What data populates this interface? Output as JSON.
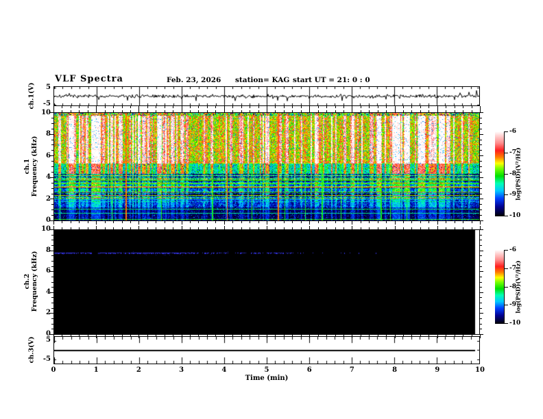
{
  "header": {
    "title": "VLF Spectra",
    "date": "Feb. 23, 2026",
    "station": "station= KAG",
    "start_ut": "start UT =  21: 0 : 0"
  },
  "chart_data": {
    "type": "heatmap",
    "title": "VLF Spectra",
    "xaxis": {
      "label": "Time (min)",
      "min": 0,
      "max": 10,
      "tick_labels": [
        "0",
        "1",
        "2",
        "3",
        "4",
        "5",
        "6",
        "7",
        "8",
        "9",
        "10"
      ],
      "minor_ticks_per_major": 5
    },
    "colorbar": {
      "label": "log(PSD)(V²/Hz)",
      "tick_labels": [
        "-6",
        "-7",
        "-8",
        "-9",
        "-10"
      ],
      "value_range": [
        -10,
        -6
      ],
      "colormap_stops": [
        [
          -10.0,
          "#000000"
        ],
        [
          -9.55,
          "#000090"
        ],
        [
          -9.15,
          "#0040ff"
        ],
        [
          -8.8,
          "#00c8ff"
        ],
        [
          -8.45,
          "#00ffb4"
        ],
        [
          -8.1,
          "#00e000"
        ],
        [
          -7.75,
          "#78ff00"
        ],
        [
          -7.5,
          "#ffff00"
        ],
        [
          -7.2,
          "#ff7800"
        ],
        [
          -6.9,
          "#ff1e1e"
        ],
        [
          -6.55,
          "#ff8c8c"
        ],
        [
          -6.2,
          "#ffd2d2"
        ],
        [
          -6.0,
          "#ffffff"
        ]
      ]
    },
    "panels": {
      "ch1_wave": {
        "ylabel": "ch.1(V)",
        "ytick_labels": [
          "5",
          "-5"
        ],
        "ylim_v": [
          -5,
          5
        ],
        "line_color": "#000000",
        "noise_amp_v": 0.45,
        "seed": 7,
        "notable_spikes": [
          {
            "t_min": 0.35,
            "amp_v": 1.6
          },
          {
            "t_min": 1.05,
            "amp_v": -1.9
          },
          {
            "t_min": 3.0,
            "amp_v": -1.5
          },
          {
            "t_min": 4.25,
            "amp_v": -2.6
          },
          {
            "t_min": 5.15,
            "amp_v": -1.4
          },
          {
            "t_min": 6.0,
            "amp_v": -1.3
          },
          {
            "t_min": 7.5,
            "amp_v": -1.2
          },
          {
            "t_min": 9.55,
            "amp_v": 1.9
          },
          {
            "t_min": 9.75,
            "amp_v": 2.3
          },
          {
            "t_min": 9.93,
            "amp_v": 3.2
          }
        ]
      },
      "ch1_spec": {
        "ylabel_line1": "ch.1",
        "ylabel_line2": "Frequency (kHz)",
        "ytick_labels": [
          "10",
          "8",
          "6",
          "4",
          "2",
          "0"
        ],
        "ylim_khz": [
          0,
          10
        ],
        "seed": 42,
        "description": "Dense broadband sferic activity: vertical red/white/green streaks above ~5 kHz, blue striped band 2-4 kHz, dark background below 2 kHz with narrowband lines",
        "bands": [
          {
            "f_min": 9.75,
            "f_max": 10.01,
            "base_psd": -8.0,
            "noise": 1.8,
            "streak_gain": 1.0,
            "speck_prob": 0.15,
            "speck_psd": -9.6
          },
          {
            "f_min": 5.3,
            "f_max": 9.75,
            "base_psd": -7.6,
            "noise": 1.3,
            "streak_gain": 1.9,
            "speck_prob": 0.05,
            "speck_psd": -8.9
          },
          {
            "f_min": 4.3,
            "f_max": 5.3,
            "base_psd": -8.55,
            "noise": 1.1,
            "streak_gain": 1.8,
            "speck_prob": 0.05,
            "speck_psd": -9.5
          },
          {
            "f_min": 2.0,
            "f_max": 4.3,
            "base_psd": -9.2,
            "noise": 0.9,
            "streak_gain": 1.25,
            "speck_prob": 0.04,
            "speck_psd": -8.4
          },
          {
            "f_min": 1.2,
            "f_max": 2.0,
            "base_psd": -9.4,
            "noise": 0.7,
            "streak_gain": 0.7,
            "speck_prob": 0.08,
            "speck_psd": -8.6
          },
          {
            "f_min": 0.0,
            "f_max": 1.2,
            "base_psd": -9.75,
            "noise": 0.45,
            "streak_gain": 0.55,
            "speck_prob": 0.05,
            "speck_psd": -9.0
          }
        ],
        "horizontal_lines_khz": [
          {
            "f": 5.45,
            "psd": -7.2
          },
          {
            "f": 3.7,
            "psd": -8.0
          },
          {
            "f": 3.4,
            "psd": -8.0
          },
          {
            "f": 3.05,
            "psd": -7.3
          },
          {
            "f": 2.3,
            "psd": -7.7
          },
          {
            "f": 1.0,
            "psd": -8.3
          },
          {
            "f": 0.64,
            "psd": -8.4
          },
          {
            "f": 0.08,
            "psd": -8.0
          }
        ],
        "vertical_event_lines": {
          "count": 16,
          "main_psd": -8.1,
          "strong_psd": -7.15
        }
      },
      "ch2_spec": {
        "ylabel_line1": "ch.2",
        "ylabel_line2": "Frequency (kHz)",
        "ytick_labels": [
          "10",
          "8",
          "6",
          "4",
          "2",
          "0"
        ],
        "ylim_khz": [
          0,
          10
        ],
        "seed": 101,
        "background_psd": -10,
        "background_color": "#000000",
        "data_end_min": 9.9,
        "signal_line": {
          "freq_khz": 7.85,
          "color": "#3232dc",
          "faint_color": "#141478",
          "segments": [
            {
              "t0": 0.0,
              "t1": 0.88,
              "density": 0.8
            },
            {
              "t0": 1.02,
              "t1": 3.3,
              "density": 0.85
            },
            {
              "t0": 3.3,
              "t1": 5.6,
              "density": 0.5
            },
            {
              "t0": 5.6,
              "t1": 6.3,
              "density": 0.18
            },
            {
              "t0": 6.3,
              "t1": 7.6,
              "density": 0.05
            }
          ]
        }
      },
      "ch3_wave": {
        "ylabel": "ch.3(V)",
        "ytick_labels": [
          "5",
          "-5"
        ],
        "ylim_v": [
          -5,
          5
        ],
        "flat_value_v": 0,
        "line_color": "#000000",
        "data_end_min": 9.9
      }
    }
  }
}
